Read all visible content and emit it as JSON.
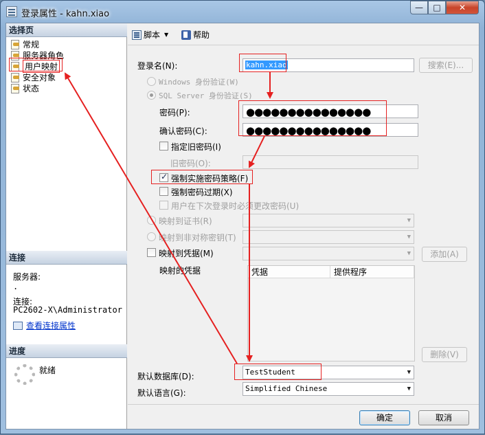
{
  "window": {
    "title": "登录属性 - kahn.xiao",
    "min": "—",
    "max": "□",
    "close": "✕"
  },
  "sidebar": {
    "pages_header": "选择页",
    "items": [
      "常规",
      "服务器角色",
      "用户映射",
      "安全对象",
      "状态"
    ],
    "connection_header": "连接",
    "server_label": "服务器:",
    "server_value": ".",
    "connection_label": "连接:",
    "connection_value": "PC2602-X\\Administrator",
    "view_props_link": "查看连接属性",
    "progress_header": "进度",
    "progress_status": "就绪"
  },
  "toolbar": {
    "script": "脚本",
    "help": "帮助"
  },
  "form": {
    "login_name_label": "登录名(N):",
    "login_name_value": "kahn.xiao",
    "search_button": "搜索(E)...",
    "windows_auth": "Windows 身份验证(W)",
    "sql_auth": "SQL Server 身份验证(S)",
    "password_label": "密码(P):",
    "password_value": "●●●●●●●●●●●●●●●",
    "confirm_label": "确认密码(C):",
    "confirm_value": "●●●●●●●●●●●●●●●",
    "specify_old_pwd": "指定旧密码(I)",
    "old_pwd_label": "旧密码(O):",
    "enforce_policy": "强制实施密码策略(F)",
    "enforce_expiration": "强制密码过期(X)",
    "must_change": "用户在下次登录时必须更改密码(U)",
    "map_cert": "映射到证书(R)",
    "map_asym_key": "映射到非对称密钥(T)",
    "map_credential": "映射到凭据(M)",
    "add_button": "添加(A)",
    "mapped_credentials": "映射的凭据",
    "grid_col_credential": "凭据",
    "grid_col_provider": "提供程序",
    "remove_button": "删除(V)",
    "default_db_label": "默认数据库(D):",
    "default_db_value": "TestStudent",
    "default_lang_label": "默认语言(G):",
    "default_lang_value": "Simplified Chinese"
  },
  "footer": {
    "ok": "确定",
    "cancel": "取消"
  },
  "colors": {
    "annotation": "#e52020"
  }
}
